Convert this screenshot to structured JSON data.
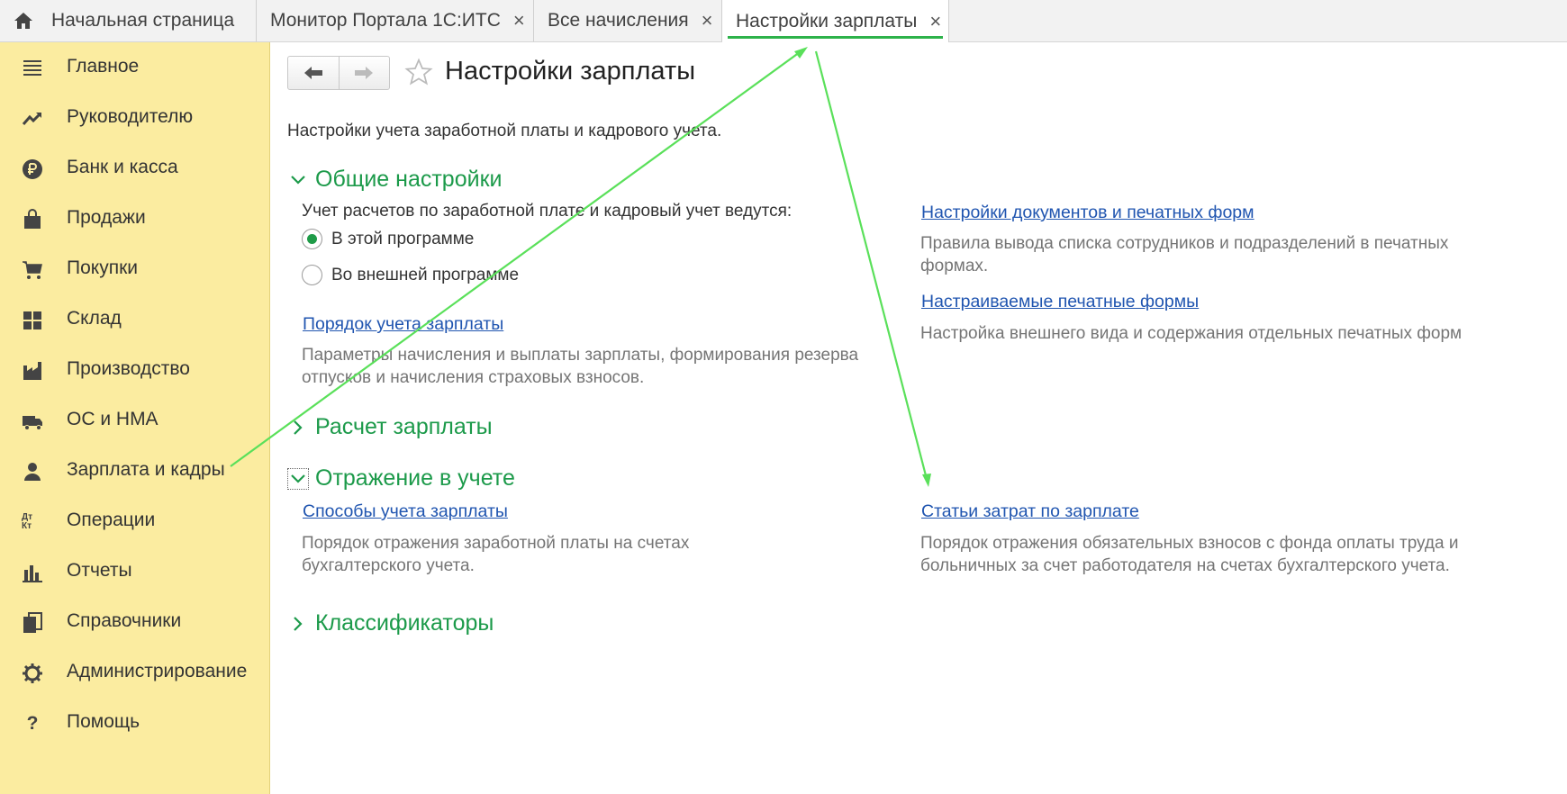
{
  "tabs": {
    "home": "Начальная страница",
    "items": [
      {
        "label": "Монитор Портала 1С:ИТС",
        "close": "×"
      },
      {
        "label": "Все начисления",
        "close": "×"
      },
      {
        "label": "Настройки зарплаты",
        "close": "×"
      }
    ]
  },
  "sidebar": {
    "items": [
      {
        "label": "Главное",
        "icon": "menu-icon"
      },
      {
        "label": "Руководителю",
        "icon": "trend-icon"
      },
      {
        "label": "Банк и касса",
        "icon": "ruble-icon"
      },
      {
        "label": "Продажи",
        "icon": "bag-icon"
      },
      {
        "label": "Покупки",
        "icon": "cart-icon"
      },
      {
        "label": "Склад",
        "icon": "warehouse-icon"
      },
      {
        "label": "Производство",
        "icon": "factory-icon"
      },
      {
        "label": "ОС и НМА",
        "icon": "truck-icon"
      },
      {
        "label": "Зарплата и кадры",
        "icon": "person-icon"
      },
      {
        "label": "Операции",
        "icon": "dt-kt-icon"
      },
      {
        "label": "Отчеты",
        "icon": "bar-chart-icon"
      },
      {
        "label": "Справочники",
        "icon": "books-icon"
      },
      {
        "label": "Администрирование",
        "icon": "gear-icon"
      },
      {
        "label": "Помощь",
        "icon": "question-icon"
      }
    ],
    "dt_kt_label": "Дт Кт",
    "help_glyph": "?"
  },
  "main": {
    "title": "Настройки зарплаты",
    "subtitle": "Настройки учета заработной платы и кадрового учета.",
    "groups": {
      "general": {
        "title": "Общие настройки",
        "question": "Учет расчетов по заработной плате и кадровый учет ведутся:",
        "radio_options": [
          "В этой программе",
          "Во внешней программе"
        ],
        "selected": "В этой программе",
        "link1": "Порядок учета зарплаты",
        "desc1": "Параметры начисления и выплаты зарплаты, формирования резерва отпусков и начисления страховых взносов.",
        "link2": "Настройки документов и печатных форм",
        "desc2": "Правила вывода списка сотрудников и подразделений в печатных формах.",
        "link3": "Настраиваемые печатные формы",
        "desc3": "Настройка внешнего вида и содержания отдельных печатных форм"
      },
      "calculation": {
        "title": "Расчет зарплаты"
      },
      "accounting": {
        "title": "Отражение в учете",
        "link1": "Способы учета зарплаты",
        "desc1": "Порядок отражения заработной платы на счетах бухгалтерского учета.",
        "link2": "Статьи затрат по зарплате",
        "desc2": "Порядок отражения обязательных взносов с фонда оплаты труда и больничных за счет работодателя на счетах бухгалтерского учета."
      },
      "classifiers": {
        "title": "Классификаторы"
      }
    }
  },
  "colors": {
    "sidebar_bg": "#fbeca0",
    "accent_green": "#1c9a4a",
    "link_blue": "#2055b0",
    "annotation_arrow": "#5ae05a"
  }
}
